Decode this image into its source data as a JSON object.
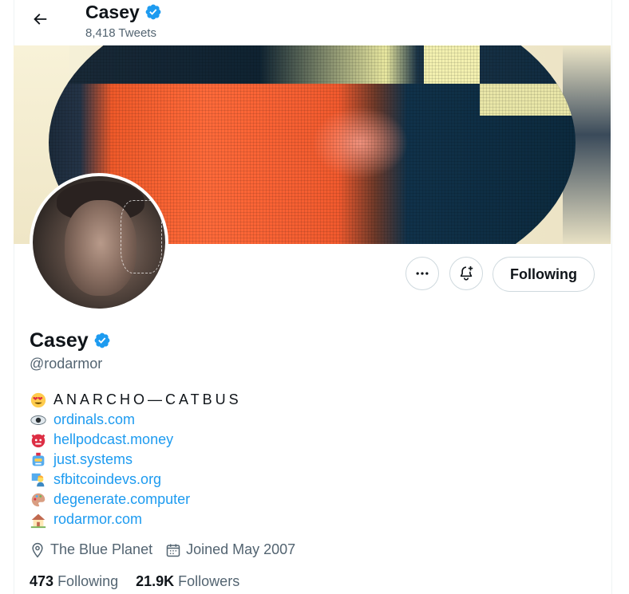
{
  "header": {
    "name": "Casey",
    "tweet_count": "8,418 Tweets"
  },
  "profile": {
    "name": "Casey",
    "handle": "@rodarmor",
    "verified": true,
    "tagline": "ANARCHO—CATBUS",
    "links": [
      {
        "emoji": "eye-icon",
        "text": "ordinals.com"
      },
      {
        "emoji": "devil-face-icon",
        "text": "hellpodcast.money"
      },
      {
        "emoji": "robot-icon",
        "text": "just.systems"
      },
      {
        "emoji": "teacher-icon",
        "text": "sfbitcoindevs.org"
      },
      {
        "emoji": "palette-icon",
        "text": "degenerate.computer"
      },
      {
        "emoji": "house-icon",
        "text": "rodarmor.com"
      }
    ],
    "location": "The Blue Planet",
    "joined": "Joined May 2007",
    "following_count": "473",
    "following_label": "Following",
    "followers_count": "21.9K",
    "followers_label": "Followers"
  },
  "actions": {
    "follow_label": "Following"
  },
  "colors": {
    "accent": "#1d9bf0",
    "muted": "#536471",
    "border": "#cfd9de"
  }
}
